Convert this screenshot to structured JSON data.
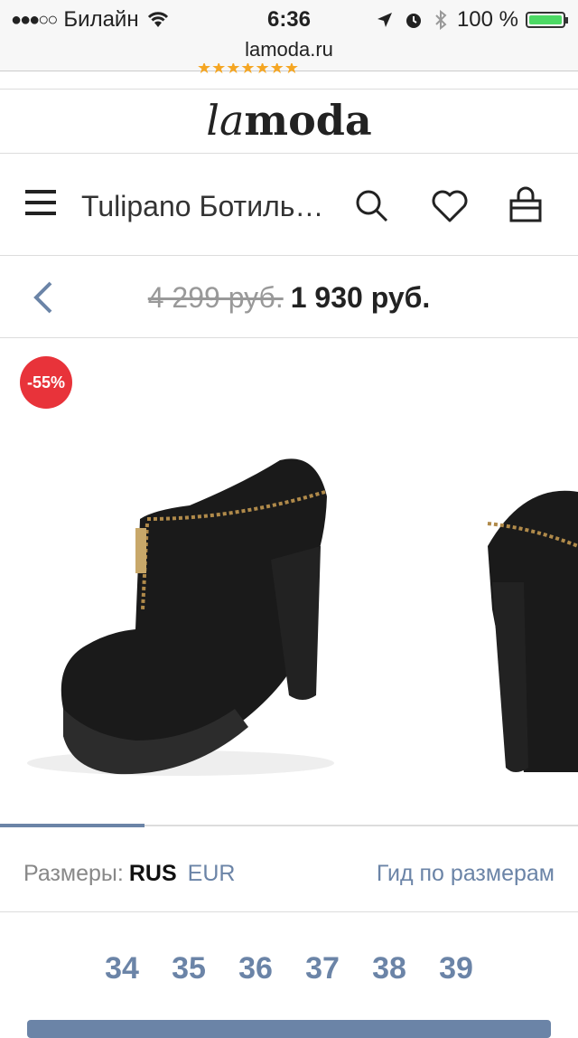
{
  "status_bar": {
    "carrier": "Билайн",
    "time": "6:36",
    "battery": "100 %"
  },
  "browser": {
    "url": "lamoda.ru"
  },
  "logo": {
    "la": "la",
    "moda": "moda"
  },
  "nav": {
    "title": "Tulipano Ботиль…"
  },
  "product": {
    "old_price": "4 299 руб.",
    "new_price": "1 930 руб.",
    "discount_badge": "-55%",
    "gallery_progress": 0.25
  },
  "sizes": {
    "label": "Размеры:",
    "rus": "RUS",
    "eur": "EUR",
    "guide": "Гид по размерам",
    "items": [
      "34",
      "35",
      "36",
      "37",
      "38",
      "39"
    ]
  },
  "colors": {
    "accent": "#6b84a7",
    "badge": "#e8333a",
    "battery": "#4cd964"
  }
}
